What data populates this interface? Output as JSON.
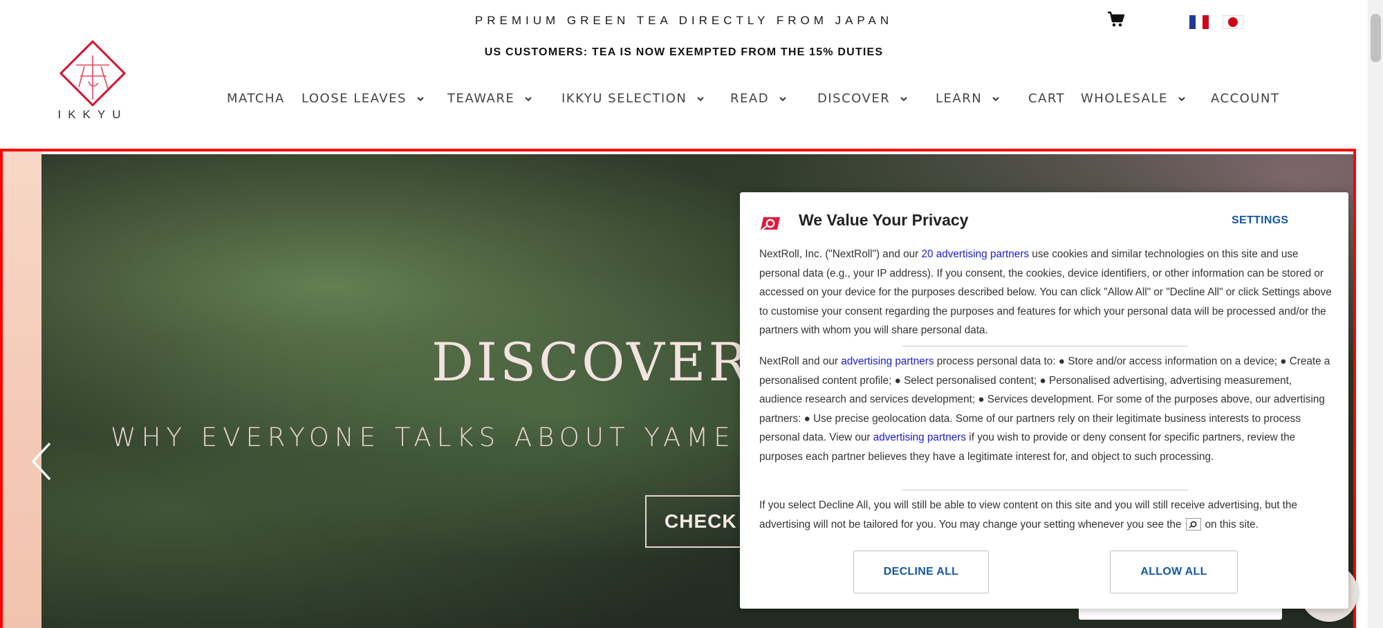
{
  "header": {
    "tagline": "PREMIUM GREEN TEA DIRECTLY FROM JAPAN",
    "notice": "US CUSTOMERS: TEA IS NOW EXEMPTED FROM THE 15% DUTIES",
    "logo_text": "IKKYU",
    "cart_icon": "shopping-cart-icon",
    "flags": [
      "french-flag-icon",
      "japanese-flag-icon"
    ]
  },
  "nav": {
    "items": [
      {
        "label": "MATCHA",
        "dropdown": false
      },
      {
        "label": "LOOSE LEAVES",
        "dropdown": true
      },
      {
        "label": "TEAWARE",
        "dropdown": true
      },
      {
        "label": "IKKYU SELECTION",
        "dropdown": true
      },
      {
        "label": "READ",
        "dropdown": true
      },
      {
        "label": "DISCOVER",
        "dropdown": true
      },
      {
        "label": "LEARN",
        "dropdown": true
      },
      {
        "label": "CART",
        "dropdown": false
      },
      {
        "label": "WHOLESALE",
        "dropdown": true
      },
      {
        "label": "ACCOUNT",
        "dropdown": false
      }
    ]
  },
  "hero": {
    "title": "DISCOVER Y",
    "subtitle": "WHY EVERYONE TALKS ABOUT YAME",
    "cta": "CHECK IT",
    "prev_icon": "chevron-left-icon"
  },
  "consent": {
    "title": "We Value Your Privacy",
    "settings": "SETTINGS",
    "p1_a": "NextRoll, Inc. (\"NextRoll\") and our ",
    "p1_link": "20 advertising partners",
    "p1_b": " use cookies and similar technologies on this site and use personal data (e.g., your IP address). If you consent, the cookies, device identifiers, or other information can be stored or accessed on your device for the purposes described below. You can click \"Allow All\" or \"Decline All\" or click Settings above to customise your consent regarding the purposes and features for which your personal data will be processed and/or the partners with whom you will share personal data.",
    "p2_a": "NextRoll and our ",
    "p2_link1": "advertising partners",
    "p2_b": " process personal data to: ● Store and/or access information on a device; ● Create a personalised content profile; ● Select personalised content; ● Personalised advertising, advertising measurement, audience research and services development; ● Services development. For some of the purposes above, our advertising partners: ● Use precise geolocation data. Some of our partners rely on their legitimate business interests to process personal data. View our ",
    "p2_link2": "advertising partners",
    "p2_c": " if you wish to provide or deny consent for specific partners, review the purposes each partner believes they have a legitimate interest for, and object to such processing.",
    "p3_a": "If you select Decline All, you will still be able to view content on this site and you will still receive advertising, but the advertising will not be tailored for you. You may change your setting whenever you see the",
    "p3_b": "on this site.",
    "decline": "DECLINE ALL",
    "allow": "ALLOW ALL"
  }
}
